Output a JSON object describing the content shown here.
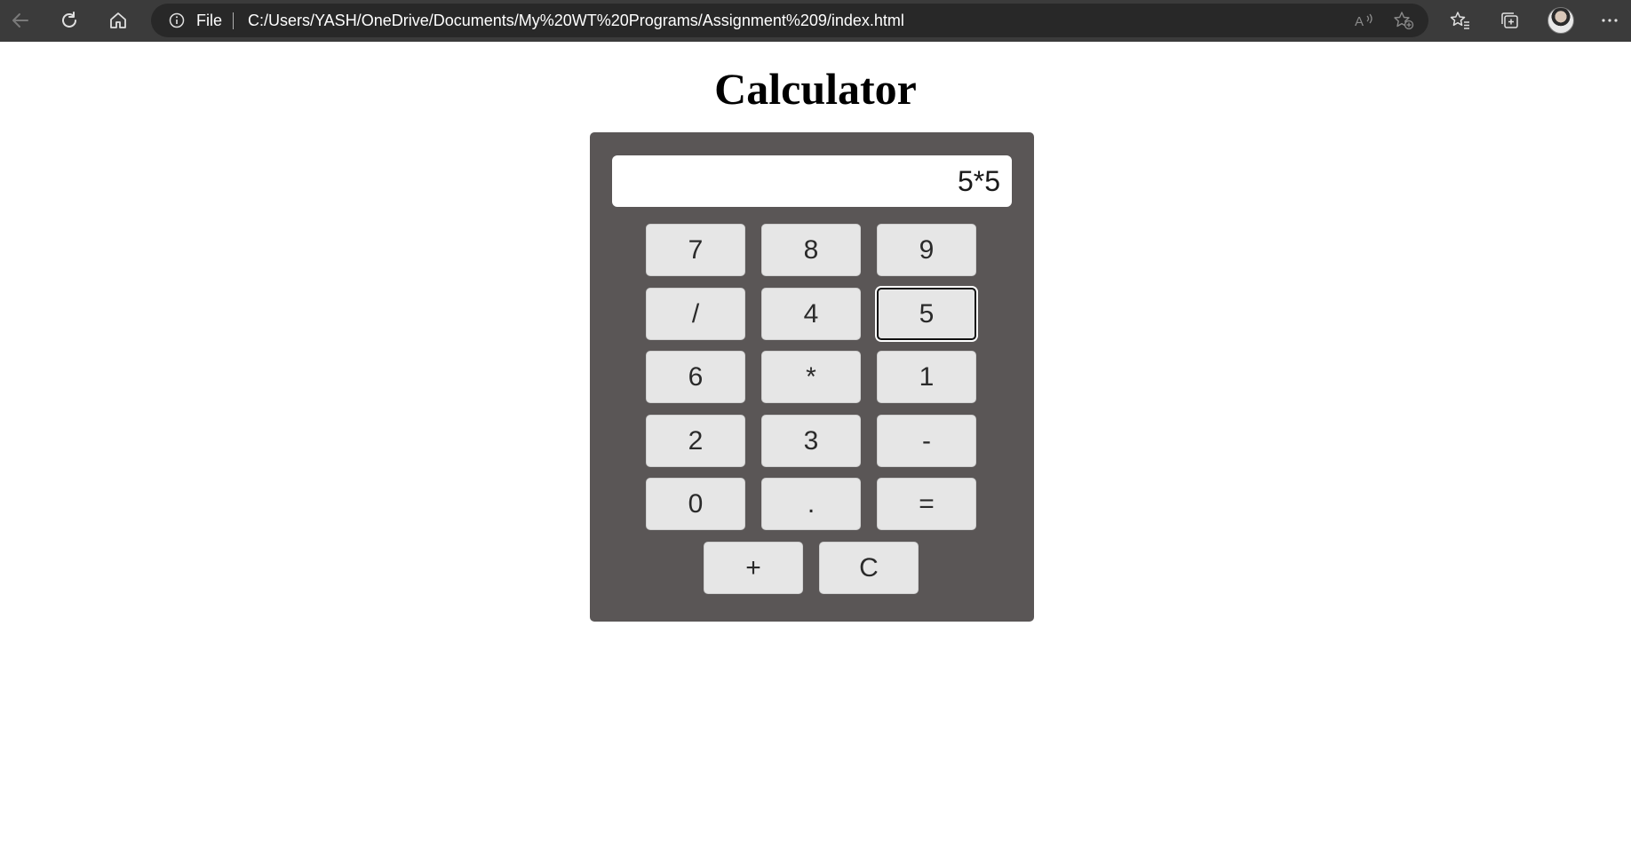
{
  "browser": {
    "address_prefix": "File",
    "url": "C:/Users/YASH/OneDrive/Documents/My%20WT%20Programs/Assignment%209/index.html",
    "icons": {
      "back": "back-arrow-icon",
      "refresh": "refresh-icon",
      "home": "home-icon",
      "info": "info-icon",
      "read_aloud": "read-aloud-icon",
      "add_favorite": "star-plus-icon",
      "favorites": "favorites-icon",
      "collections": "collections-icon",
      "profile": "avatar",
      "more": "more-icon"
    }
  },
  "page": {
    "title": "Calculator"
  },
  "calculator": {
    "display_value": "5*5",
    "focused_key": "5",
    "keys": [
      [
        "7",
        "8",
        "9"
      ],
      [
        "/",
        "4",
        "5"
      ],
      [
        "6",
        "*",
        "1"
      ],
      [
        "2",
        "3",
        "-"
      ],
      [
        "0",
        ".",
        "="
      ],
      [
        "+",
        "C"
      ]
    ]
  },
  "colors": {
    "toolbar": "#3b3b3b",
    "address_bar": "#282828",
    "calculator_body": "#5a5656",
    "key_bg": "#e6e6e6"
  }
}
